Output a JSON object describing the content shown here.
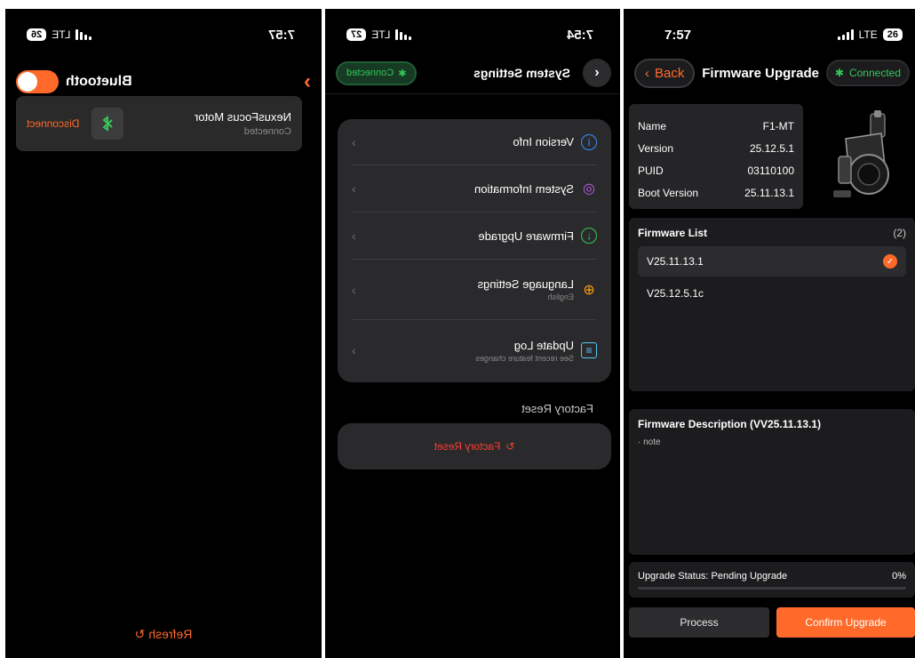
{
  "panel1": {
    "status": {
      "time": "7:57",
      "network": "LTE",
      "battery": "26"
    },
    "header": {
      "title": "Bluetooth",
      "chevron": "›"
    },
    "device": {
      "name": "NexusFocus Motor",
      "status": "Connected",
      "disconnect_label": "Disconnect"
    },
    "refresh_label": "Refresh",
    "refresh_glyph": "↻"
  },
  "panel2": {
    "status": {
      "time": "7:54",
      "network": "LTE",
      "battery": "27"
    },
    "header": {
      "title": "System Settings",
      "back_glyph": "‹",
      "connected_label": "Connected"
    },
    "settings": [
      {
        "title": "Version Info",
        "subtitle": "",
        "icon": "info-icon",
        "icon_glyph": "i",
        "color": "#3a8dff"
      },
      {
        "title": "System Information",
        "subtitle": "",
        "icon": "target-icon",
        "icon_glyph": "◎",
        "color": "#bf5af2"
      },
      {
        "title": "Firmware Upgrade",
        "subtitle": "",
        "icon": "download-icon",
        "icon_glyph": "↓",
        "color": "#34c759"
      },
      {
        "title": "Language Settings",
        "subtitle": "English",
        "icon": "globe-icon",
        "icon_glyph": "⊕",
        "color": "#ff9f0a"
      },
      {
        "title": "Update Log",
        "subtitle": "See recent feature changes",
        "icon": "document-icon",
        "icon_glyph": "≡",
        "color": "#5ac8fa"
      }
    ],
    "section_label": "Factory Reset",
    "reset_label": "Factory Reset",
    "reset_glyph": "↻",
    "chevron_glyph": "›"
  },
  "panel3": {
    "status": {
      "time": "7:57",
      "network": "LTE",
      "battery": "26"
    },
    "header": {
      "back_label": "Back",
      "back_glyph": "‹",
      "title": "Firmware Upgrade",
      "connected_label": "Connected"
    },
    "device_info": [
      {
        "label": "Name",
        "value": "F1-MT"
      },
      {
        "label": "Version",
        "value": "25.12.5.1"
      },
      {
        "label": "PUID",
        "value": "03110100"
      },
      {
        "label": "Boot Version",
        "value": "25.11.13.1"
      }
    ],
    "firmware_list": {
      "title": "Firmware List",
      "count": "(2)",
      "items": [
        "V25.11.13.1",
        "V25.12.5.1c"
      ],
      "selected_index": 0,
      "check_glyph": "✓"
    },
    "description": {
      "title": "Firmware Description (VV25.11.13.1)",
      "note": "· note"
    },
    "upgrade": {
      "status_label": "Upgrade Status: Pending Upgrade",
      "percent_label": "0%",
      "progress": 0
    },
    "buttons": {
      "process": "Process",
      "confirm": "Confirm Upgrade"
    }
  },
  "colors": {
    "accent": "#ff6a2b",
    "connected": "#34c759",
    "danger": "#ff3b30"
  }
}
